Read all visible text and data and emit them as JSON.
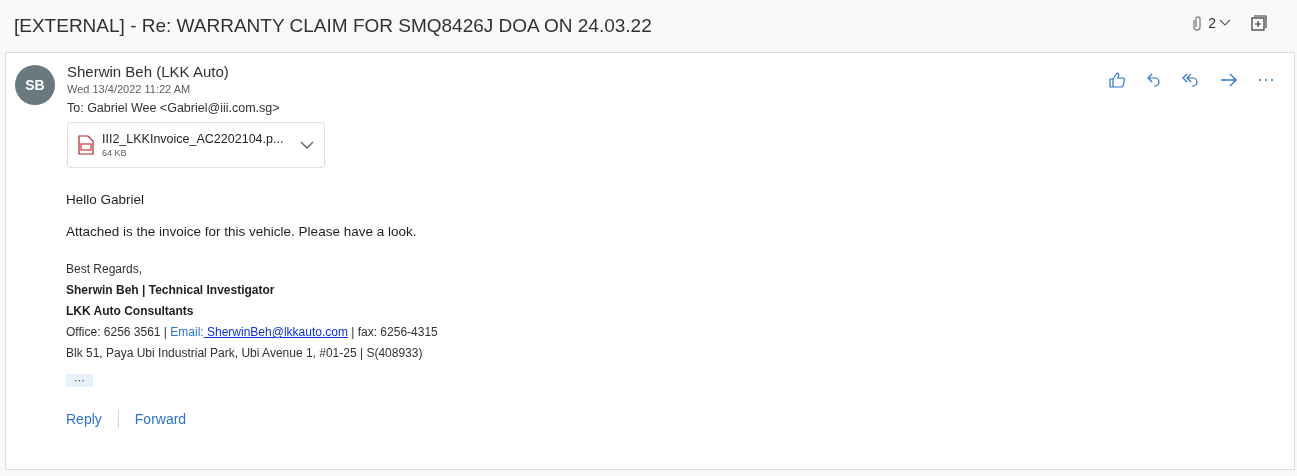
{
  "subject": "[EXTERNAL] - Re: WARRANTY CLAIM FOR SMQ8426J DOA ON 24.03.22",
  "attachment_count": "2",
  "message": {
    "avatar_initials": "SB",
    "sender": "Sherwin Beh (LKK Auto)",
    "date": "Wed 13/4/2022 11:22 AM",
    "to": "To: Gabriel Wee <Gabriel@iii.com.sg>",
    "attachment": {
      "name": "III2_LKKInvoice_AC2202104.p...",
      "size": "64 KB"
    },
    "body": [
      "Hello Gabriel",
      "Attached is the invoice for this vehicle. Please have a look."
    ],
    "signature": [
      {
        "kind": "plain",
        "text": "Best Regards,"
      },
      {
        "kind": "bold",
        "text": "Sherwin Beh | Technical Investigator"
      },
      {
        "kind": "bold",
        "text": "LKK Auto Consultants"
      },
      {
        "kind": "contact",
        "office": "Office: 6256 3561  |",
        "email_label": "Email:",
        "email": " SherwinBeh@lkkauto.com",
        "fax": "| fax: 6256-4315"
      },
      {
        "kind": "plain",
        "text": "Blk 51, Paya Ubi Industrial Park, Ubi Avenue 1, #01-25 | S(408933)"
      }
    ],
    "more": "···",
    "actions": [
      "Reply",
      "Forward"
    ]
  }
}
